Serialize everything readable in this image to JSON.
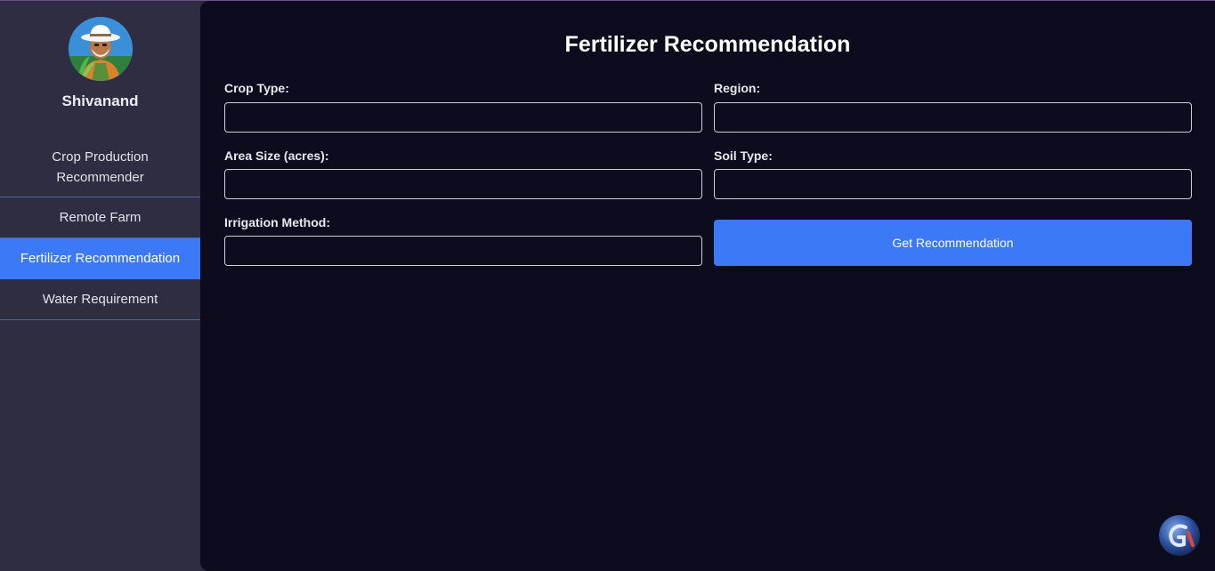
{
  "user": {
    "name": "Shivanand"
  },
  "sidebar": {
    "items": [
      {
        "label": "Crop Production Recommender"
      },
      {
        "label": "Remote Farm"
      },
      {
        "label": "Fertilizer Recommendation",
        "active": true
      },
      {
        "label": "Water Requirement"
      }
    ]
  },
  "form": {
    "title": "Fertilizer Recommendation",
    "fields": {
      "crop_type": {
        "label": "Crop Type:",
        "value": ""
      },
      "region": {
        "label": "Region:",
        "value": ""
      },
      "area_size": {
        "label": "Area Size (acres):",
        "value": ""
      },
      "soil_type": {
        "label": "Soil Type:",
        "value": ""
      },
      "irrigation_method": {
        "label": "Irrigation Method:",
        "value": ""
      }
    },
    "submit_label": "Get Recommendation"
  },
  "colors": {
    "sidebar_bg": "#2e2d42",
    "main_bg": "#0d0c1f",
    "accent": "#3b79f6",
    "divider": "#4a64a8"
  },
  "icons": {
    "avatar": "farmer-avatar-icon",
    "floating_button": "assistant-logo-icon"
  }
}
